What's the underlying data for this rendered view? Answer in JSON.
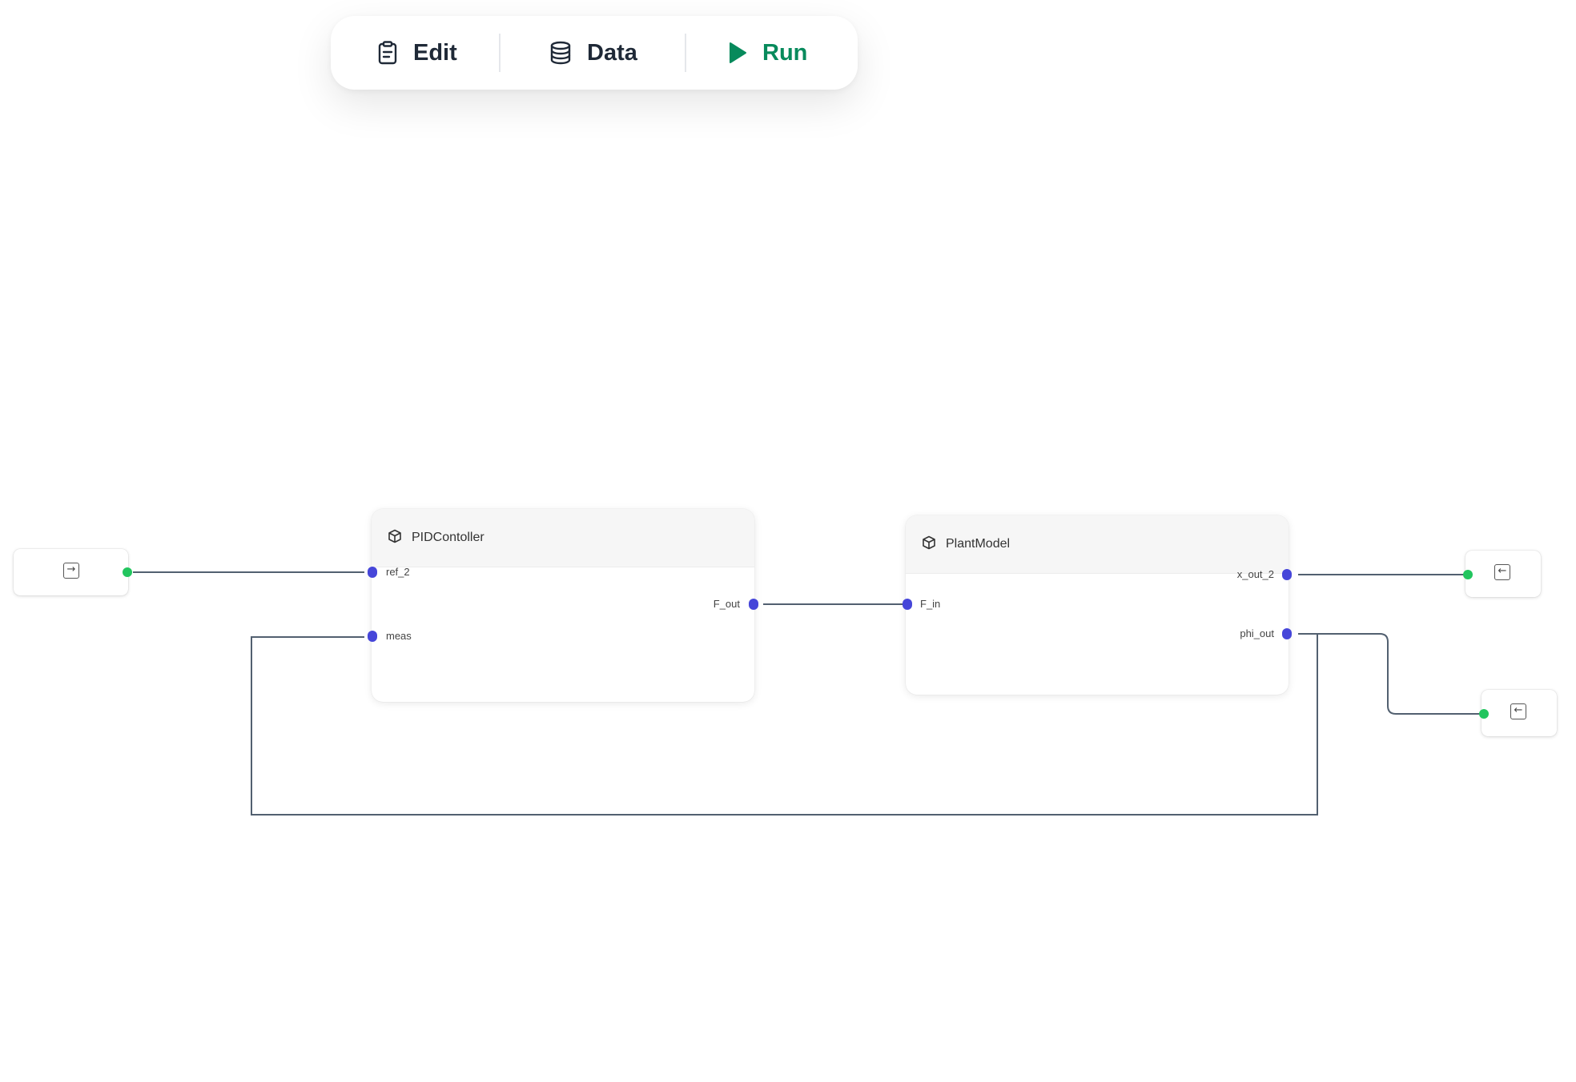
{
  "toolbar": {
    "edit_label": "Edit",
    "data_label": "Data",
    "run_label": "Run",
    "run_color": "#078a5c"
  },
  "nodes": {
    "pid": {
      "title": "PIDContoller",
      "inputs": [
        "ref_2",
        "meas"
      ],
      "outputs": [
        "F_out"
      ]
    },
    "plant": {
      "title": "PlantModel",
      "inputs": [
        "F_in"
      ],
      "outputs": [
        "x_out_2",
        "phi_out"
      ]
    }
  },
  "io_nodes": {
    "source_icon": "→",
    "sink_icon": "←"
  },
  "colors": {
    "port": "#4646d9",
    "io_port": "#22c55e",
    "wire": "#526070"
  }
}
